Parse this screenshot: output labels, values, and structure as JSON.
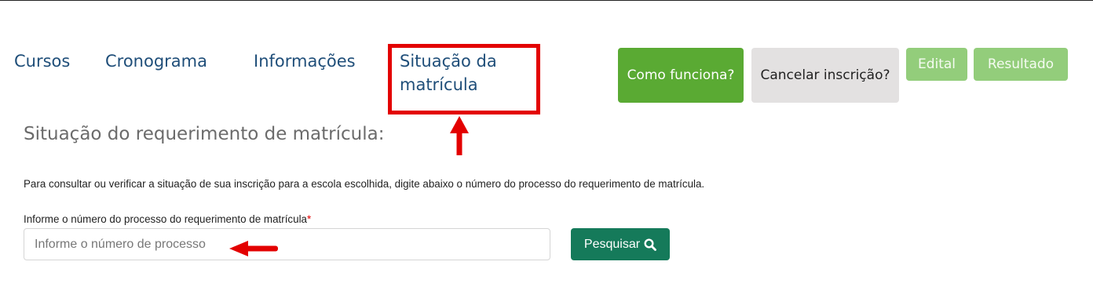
{
  "nav": {
    "items": [
      {
        "label": "Cursos"
      },
      {
        "label": "Cronograma"
      },
      {
        "label": "Informações"
      },
      {
        "label": "Situação da matrícula"
      }
    ]
  },
  "actions": {
    "como_funciona": "Como funciona?",
    "cancelar_inscricao": "Cancelar inscrição?",
    "edital": "Edital",
    "resultado": "Resultado"
  },
  "main": {
    "title": "Situação do requerimento de matrícula:",
    "description": "Para consultar ou verificar a situação de sua inscrição para a escola escolhida, digite abaixo o número do processo do requerimento de matrícula.",
    "field_label": "Informe o número do processo do requerimento de matrícula",
    "required_mark": "*",
    "input_placeholder": "Informe o número de processo",
    "search_button": "Pesquisar"
  },
  "colors": {
    "nav_text": "#1f4e79",
    "primary_green": "#5aaa33",
    "light_green": "#93cd7b",
    "gray_button": "#e3e1e1",
    "search_button": "#157a5a",
    "annotation_red": "#e30000"
  },
  "icons": {
    "search": "search-icon"
  }
}
